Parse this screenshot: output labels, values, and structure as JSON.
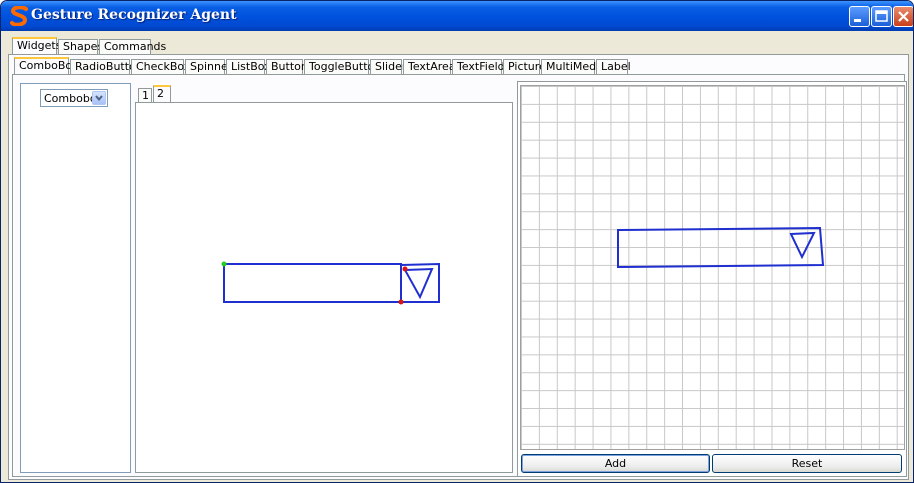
{
  "window": {
    "title": "Gesture Recognizer Agent"
  },
  "icons": {
    "app": "s-logo-icon",
    "minimize": "minimize-icon",
    "maximize": "maximize-icon",
    "close": "close-icon",
    "dropdown": "chevron-down-icon"
  },
  "top_tabs": [
    "Widgets",
    "Shapes",
    "Commands"
  ],
  "top_tab_selected": "Widgets",
  "widget_tabs": [
    "ComboBox",
    "RadioButton",
    "CheckBox",
    "Spinner",
    "ListBox",
    "Button",
    "ToggleButton",
    "Slider",
    "TextArea",
    "TextField",
    "Picture",
    "MultiMedia",
    "Label"
  ],
  "widget_tab_selected": "ComboBox",
  "left_panel": {
    "combo_value": "Combobox"
  },
  "sample_tabs": [
    "1",
    "2"
  ],
  "sample_tab_selected": "2",
  "buttons": {
    "add": "Add",
    "reset": "Reset"
  },
  "colors": {
    "stroke": "#1f2fd0",
    "title_bar": "#0052df",
    "start_point": "#22cc22",
    "end_point": "#dd1111"
  }
}
